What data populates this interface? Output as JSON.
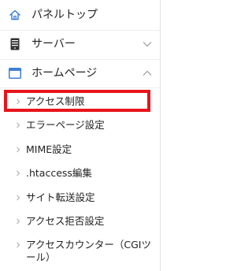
{
  "sidebar": {
    "top_items": [
      {
        "label": "パネルトップ",
        "icon": "home-icon"
      },
      {
        "label": "サーバー",
        "icon": "server-icon",
        "chevron": "chevron-down-icon"
      },
      {
        "label": "ホームページ",
        "icon": "window-icon",
        "chevron": "chevron-up-icon"
      }
    ],
    "sub_items": [
      {
        "label": "アクセス制限",
        "highlighted": true
      },
      {
        "label": "エラーページ設定"
      },
      {
        "label": "MIME設定"
      },
      {
        "label": ".htaccess編集"
      },
      {
        "label": "サイト転送設定"
      },
      {
        "label": "アクセス拒否設定"
      },
      {
        "label": "アクセスカウンター（CGIツール）"
      }
    ]
  },
  "colors": {
    "accent_icon": "#3d7fd8",
    "highlight_border": "#e8141b",
    "text": "#222222",
    "muted": "#999999"
  }
}
